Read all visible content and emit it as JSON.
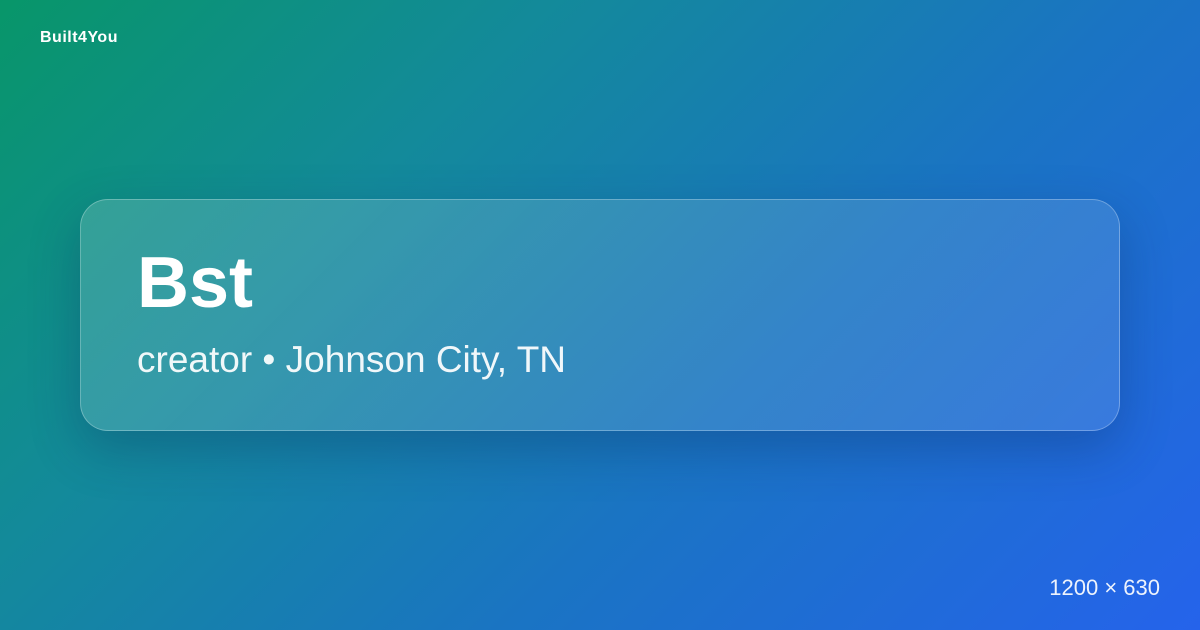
{
  "brand": {
    "name": "Built4You"
  },
  "card": {
    "title": "Bst",
    "subtitle": "creator • Johnson City, TN"
  },
  "footer": {
    "dimensions": "1200 × 630"
  },
  "colors": {
    "gradient_start": "#089669",
    "gradient_mid": "#1a74c3",
    "gradient_end": "#2563eb",
    "text": "#ffffff"
  }
}
